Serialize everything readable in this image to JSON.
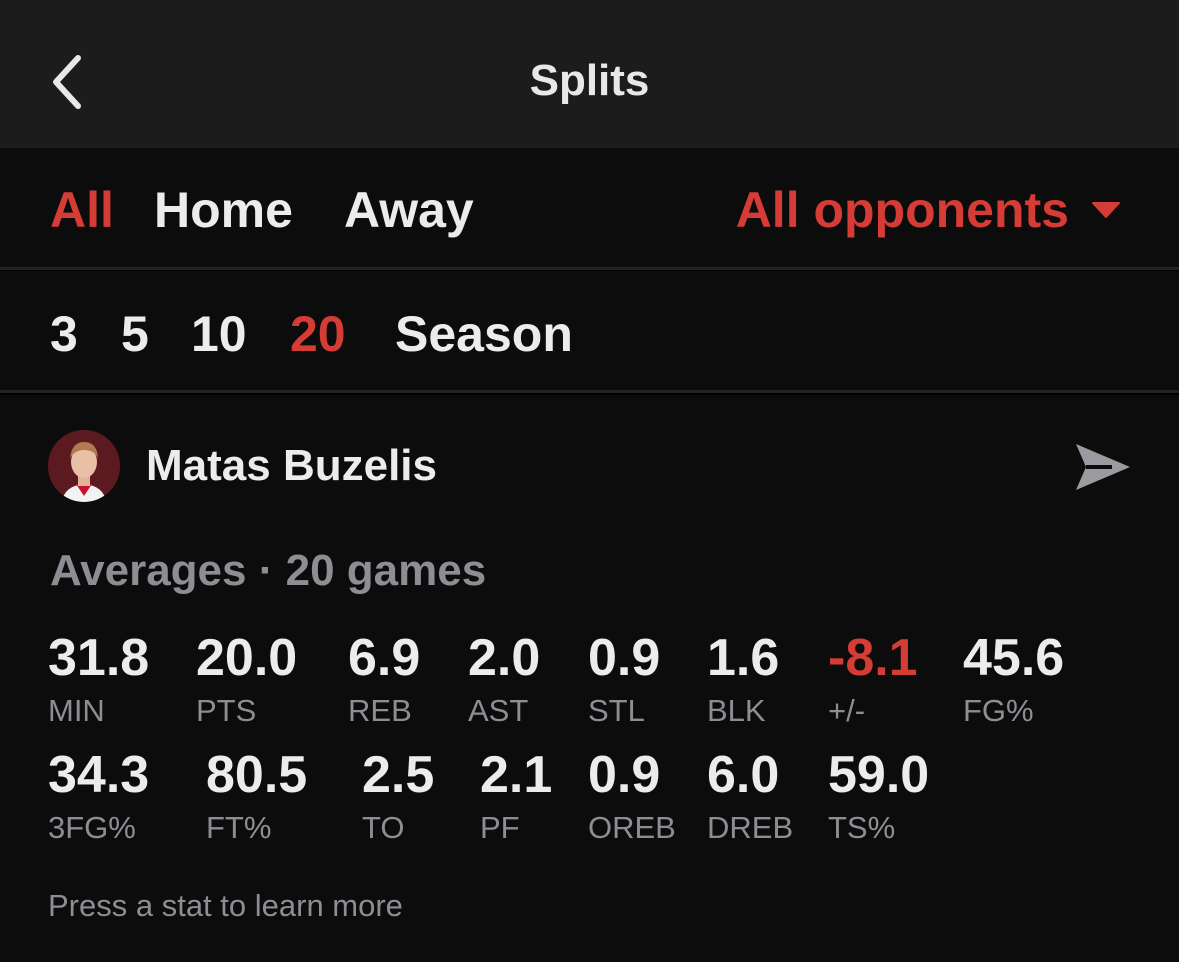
{
  "header": {
    "title": "Splits"
  },
  "location_tabs": [
    {
      "label": "All",
      "active": true
    },
    {
      "label": "Home",
      "active": false
    },
    {
      "label": "Away",
      "active": false
    }
  ],
  "opponent_filter": {
    "label": "All opponents"
  },
  "game_tabs": [
    {
      "label": "3",
      "active": false
    },
    {
      "label": "5",
      "active": false
    },
    {
      "label": "10",
      "active": false
    },
    {
      "label": "20",
      "active": true
    },
    {
      "label": "Season",
      "active": false
    }
  ],
  "player": {
    "name": "Matas Buzelis"
  },
  "averages": {
    "heading": "Averages · 20 games"
  },
  "stats_row1": [
    {
      "value": "31.8",
      "label": "MIN"
    },
    {
      "value": "20.0",
      "label": "PTS"
    },
    {
      "value": "6.9",
      "label": "REB"
    },
    {
      "value": "2.0",
      "label": "AST"
    },
    {
      "value": "0.9",
      "label": "STL"
    },
    {
      "value": "1.6",
      "label": "BLK"
    },
    {
      "value": "-8.1",
      "label": "+/-"
    },
    {
      "value": "45.6",
      "label": "FG%"
    }
  ],
  "stats_row2": [
    {
      "value": "34.3",
      "label": "3FG%"
    },
    {
      "value": "80.5",
      "label": "FT%"
    },
    {
      "value": "2.5",
      "label": "TO"
    },
    {
      "value": "2.1",
      "label": "PF"
    },
    {
      "value": "0.9",
      "label": "OREB"
    },
    {
      "value": "6.0",
      "label": "DREB"
    },
    {
      "value": "59.0",
      "label": "TS%"
    }
  ],
  "hint": "Press a stat to learn more",
  "colors": {
    "accent": "#d63c36",
    "muted": "#8d8d93",
    "text": "#ececec",
    "navbar": "#1c1c1c"
  }
}
